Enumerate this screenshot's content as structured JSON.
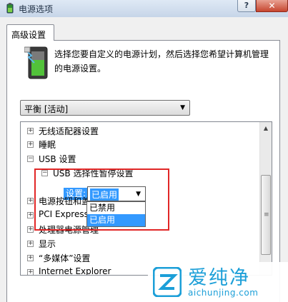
{
  "window": {
    "title": "电源选项",
    "help_label": "?",
    "close_label": "✕"
  },
  "tab": {
    "label": "高级设置"
  },
  "description": "选择您要自定义的电源计划，然后选择您希望计算机管理的电源设置。",
  "plan_select": {
    "value": "平衡 [活动]"
  },
  "tree": {
    "items": [
      {
        "label": "无线适配器设置",
        "expander": "+"
      },
      {
        "label": "睡眠",
        "expander": "+"
      },
      {
        "label": "USB 设置",
        "expander": "−"
      },
      {
        "label": "USB 选择性暂停设置",
        "expander": "−"
      },
      {
        "label": "电源按钮和盖",
        "expander": "+"
      },
      {
        "label": "PCI Express",
        "expander": "+"
      },
      {
        "label": "处理器电源管理",
        "expander": "+"
      },
      {
        "label": "显示",
        "expander": "+"
      },
      {
        "label": "“多媒体”设置",
        "expander": "+"
      },
      {
        "label": "Internet Explorer",
        "expander": "+"
      }
    ],
    "setting": {
      "label": "设置:",
      "value": "已启用",
      "options": [
        "已禁用",
        "已启用"
      ],
      "selected_option": "已启用"
    }
  },
  "watermark": {
    "name": "爱纯净",
    "url": "aichunjing.com"
  },
  "colors": {
    "selection": "#3399ff",
    "highlight_border": "#e12727",
    "watermark": "#1c9fd8"
  }
}
